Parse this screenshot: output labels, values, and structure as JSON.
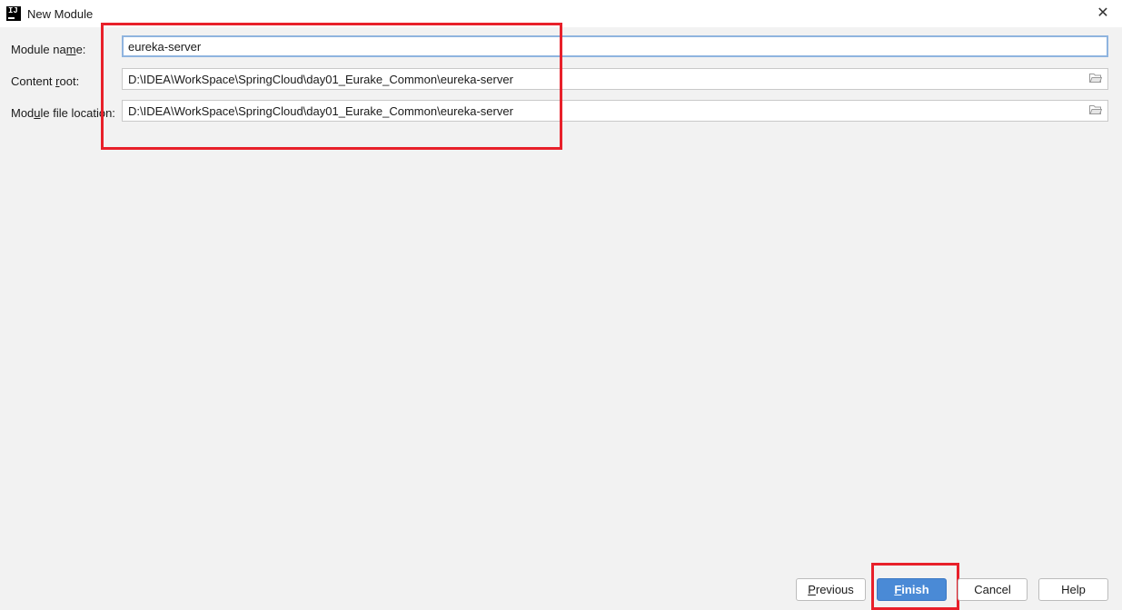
{
  "window": {
    "title": "New Module",
    "close_glyph": "✕"
  },
  "form": {
    "module_name": {
      "label_pre": "Module na",
      "label_mn": "m",
      "label_post": "e:",
      "value": "eureka-server"
    },
    "content_root": {
      "label_pre": "Content ",
      "label_mn": "r",
      "label_post": "oot:",
      "value": "D:\\IDEA\\WorkSpace\\SpringCloud\\day01_Eurake_Common\\eureka-server"
    },
    "module_file_location": {
      "label_pre": "Mod",
      "label_mn": "u",
      "label_post": "le file location:",
      "value": "D:\\IDEA\\WorkSpace\\SpringCloud\\day01_Eurake_Common\\eureka-server"
    }
  },
  "buttons": {
    "previous": {
      "pre": "",
      "mn": "P",
      "post": "revious"
    },
    "finish": {
      "pre": "",
      "mn": "F",
      "post": "inish"
    },
    "cancel": {
      "label": "Cancel"
    },
    "help": {
      "label": "Help"
    }
  },
  "icons": {
    "app": "intellij-icon",
    "folder": "folder-open-icon"
  },
  "colors": {
    "highlight": "#e8202a",
    "primary_button": "#4a8ad6",
    "focus_border": "#8fb4df"
  }
}
